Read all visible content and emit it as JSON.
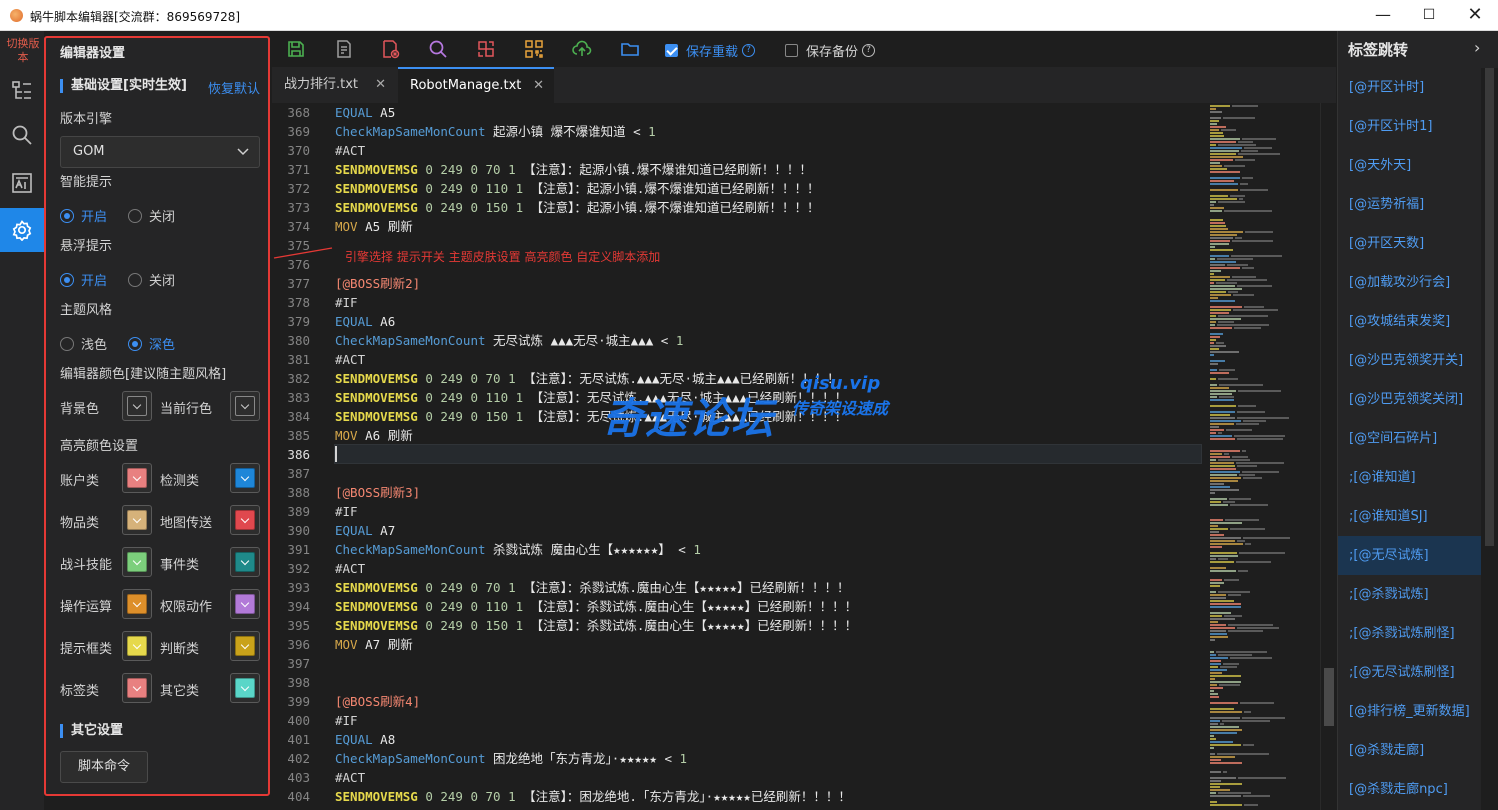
{
  "window": {
    "title": "蜗牛脚本编辑器[交流群：869569728]",
    "min": "—",
    "max": "☐",
    "close": "✕"
  },
  "activity": {
    "switch_label": "切换版本"
  },
  "settings": {
    "heading": "编辑器设置",
    "basic_section": "基础设置[实时生效]",
    "restore_default": "恢复默认",
    "engine_label": "版本引擎",
    "engine_value": "GOM",
    "smart_hint_label": "智能提示",
    "hover_hint_label": "悬浮提示",
    "theme_label": "主题风格",
    "on": "开启",
    "off": "关闭",
    "light": "浅色",
    "dark": "深色",
    "editor_color_label": "编辑器颜色[建议随主题风格]",
    "bg_color": "背景色",
    "current_line_color": "当前行色",
    "highlight_label": "高亮颜色设置",
    "colors": [
      {
        "a": "账户类",
        "ac": "#e88080",
        "b": "检测类",
        "bc": "#1e86d8"
      },
      {
        "a": "物品类",
        "ac": "#d6b27a",
        "b": "地图传送",
        "bc": "#e0484e"
      },
      {
        "a": "战斗技能",
        "ac": "#7ccf7c",
        "b": "事件类",
        "bc": "#1f8a8a"
      },
      {
        "a": "操作运算",
        "ac": "#dd8f2a",
        "b": "权限动作",
        "bc": "#b27ad8"
      },
      {
        "a": "提示框类",
        "ac": "#e6d94c",
        "b": "判断类",
        "bc": "#c9a21a"
      },
      {
        "a": "标签类",
        "ac": "#e88080",
        "b": "其它类",
        "bc": "#5ad6c8"
      }
    ],
    "other_section": "其它设置",
    "script_cmd_button": "脚本命令"
  },
  "toolbar": {
    "save_reload": "保存重载",
    "save_backup": "保存备份",
    "help": "?"
  },
  "tabs": [
    {
      "label": "战力排行.txt",
      "close": "✕"
    },
    {
      "label": "RobotManage.txt",
      "close": "✕"
    }
  ],
  "editor": {
    "annotation": "引擎选择 提示开关 主题皮肤设置 高亮颜色 自定义脚本添加",
    "watermark": "奇速论坛",
    "watermark_url": "qisu.vip",
    "watermark_sub": "传奇架设速成",
    "lines": [
      {
        "n": "368",
        "t": "a",
        "p1": "EQUAL",
        "p2": " A5"
      },
      {
        "n": "369",
        "t": "c",
        "p1": "CheckMapSameMonCount",
        "p2": " 起源小镇 爆不爆谁知道 < ",
        "p3": "1"
      },
      {
        "n": "370",
        "t": "h",
        "p1": "#ACT"
      },
      {
        "n": "371",
        "t": "s",
        "p1": "SENDMOVEMSG",
        "p2": " 0 249 0 70 1 ",
        "p3": " 【注意】：起源小镇.爆不爆谁知道已经刷新！！！！"
      },
      {
        "n": "372",
        "t": "s",
        "p1": "SENDMOVEMSG",
        "p2": " 0 249 0 110 1",
        "p3": " 【注意】：起源小镇.爆不爆谁知道已经刷新！！！！"
      },
      {
        "n": "373",
        "t": "s",
        "p1": "SENDMOVEMSG",
        "p2": " 0 249 0 150 1",
        "p3": " 【注意】：起源小镇.爆不爆谁知道已经刷新！！！！"
      },
      {
        "n": "374",
        "t": "m",
        "p1": "MOV",
        "p2": " A5 ",
        "p3": "刷新"
      },
      {
        "n": "375",
        "t": "e"
      },
      {
        "n": "376",
        "t": "e"
      },
      {
        "n": "377",
        "t": "l",
        "p1": "[@BOSS刷新2]"
      },
      {
        "n": "378",
        "t": "h",
        "p1": "#IF"
      },
      {
        "n": "379",
        "t": "a",
        "p1": "EQUAL",
        "p2": " A6"
      },
      {
        "n": "380",
        "t": "c",
        "p1": "CheckMapSameMonCount",
        "p2": " 无尽试炼 ▲▲▲无尽·城主▲▲▲ < ",
        "p3": "1"
      },
      {
        "n": "381",
        "t": "h",
        "p1": "#ACT"
      },
      {
        "n": "382",
        "t": "s",
        "p1": "SENDMOVEMSG",
        "p2": " 0 249 0 70 1 ",
        "p3": " 【注意】：无尽试炼.▲▲▲无尽·城主▲▲▲已经刷新！！！！"
      },
      {
        "n": "383",
        "t": "s",
        "p1": "SENDMOVEMSG",
        "p2": " 0 249 0 110 1",
        "p3": " 【注意】：无尽试炼.▲▲▲无尽·城主▲▲▲已经刷新！！！！"
      },
      {
        "n": "384",
        "t": "s",
        "p1": "SENDMOVEMSG",
        "p2": " 0 249 0 150 1",
        "p3": " 【注意】：无尽试炼.▲▲▲无尽·城主▲▲▲已经刷新！！！！"
      },
      {
        "n": "385",
        "t": "m",
        "p1": "MOV",
        "p2": " A6 ",
        "p3": "刷新"
      },
      {
        "n": "386",
        "t": "e",
        "cur": true
      },
      {
        "n": "387",
        "t": "e"
      },
      {
        "n": "388",
        "t": "l",
        "p1": "[@BOSS刷新3]"
      },
      {
        "n": "389",
        "t": "h",
        "p1": "#IF"
      },
      {
        "n": "390",
        "t": "a",
        "p1": "EQUAL",
        "p2": " A7"
      },
      {
        "n": "391",
        "t": "c",
        "p1": "CheckMapSameMonCount",
        "p2": " 杀戮试炼 魔由心生【★★★★★★】  < ",
        "p3": "1"
      },
      {
        "n": "392",
        "t": "h",
        "p1": "#ACT"
      },
      {
        "n": "393",
        "t": "s",
        "p1": "SENDMOVEMSG",
        "p2": " 0 249 0 70 1 ",
        "p3": " 【注意】：杀戮试炼.魔由心生【★★★★★】已经刷新！！！！"
      },
      {
        "n": "394",
        "t": "s",
        "p1": "SENDMOVEMSG",
        "p2": " 0 249 0 110 1",
        "p3": " 【注意】：杀戮试炼.魔由心生【★★★★★】已经刷新！！！！"
      },
      {
        "n": "395",
        "t": "s",
        "p1": "SENDMOVEMSG",
        "p2": " 0 249 0 150 1",
        "p3": " 【注意】：杀戮试炼.魔由心生【★★★★★】已经刷新！！！！"
      },
      {
        "n": "396",
        "t": "m",
        "p1": "MOV",
        "p2": " A7 ",
        "p3": "刷新"
      },
      {
        "n": "397",
        "t": "e"
      },
      {
        "n": "398",
        "t": "e"
      },
      {
        "n": "399",
        "t": "l",
        "p1": "[@BOSS刷新4]"
      },
      {
        "n": "400",
        "t": "h",
        "p1": "#IF"
      },
      {
        "n": "401",
        "t": "a",
        "p1": "EQUAL",
        "p2": " A8"
      },
      {
        "n": "402",
        "t": "c",
        "p1": "CheckMapSameMonCount",
        "p2": " 困龙绝地「东方青龙」·★★★★★  < ",
        "p3": "1"
      },
      {
        "n": "403",
        "t": "h",
        "p1": "#ACT"
      },
      {
        "n": "404",
        "t": "s",
        "p1": "SENDMOVEMSG",
        "p2": " 0 249 0 70 1 ",
        "p3": " 【注意】：困龙绝地.「东方青龙」·★★★★★已经刷新！！！！"
      }
    ]
  },
  "right_panel": {
    "title": "标签跳转",
    "chevron": "›",
    "items": [
      "[@开区计时]",
      "[@开区计时1]",
      "[@天外天]",
      "[@运势祈福]",
      "[@开区天数]",
      "[@加载攻沙行会]",
      "[@攻城结束发奖]",
      "[@沙巴克领奖开关]",
      "[@沙巴克领奖关闭]",
      "[@空间石碎片]",
      ";[@谁知道]",
      ";[@谁知道SJ]",
      ";[@无尽试炼]",
      ";[@杀戮试炼]",
      ";[@杀戮试炼刷怪]",
      ";[@无尽试炼刷怪]",
      "[@排行榜_更新数据]",
      "[@杀戮走廊]",
      "[@杀戮走廊npc]"
    ],
    "active_index": 12
  }
}
